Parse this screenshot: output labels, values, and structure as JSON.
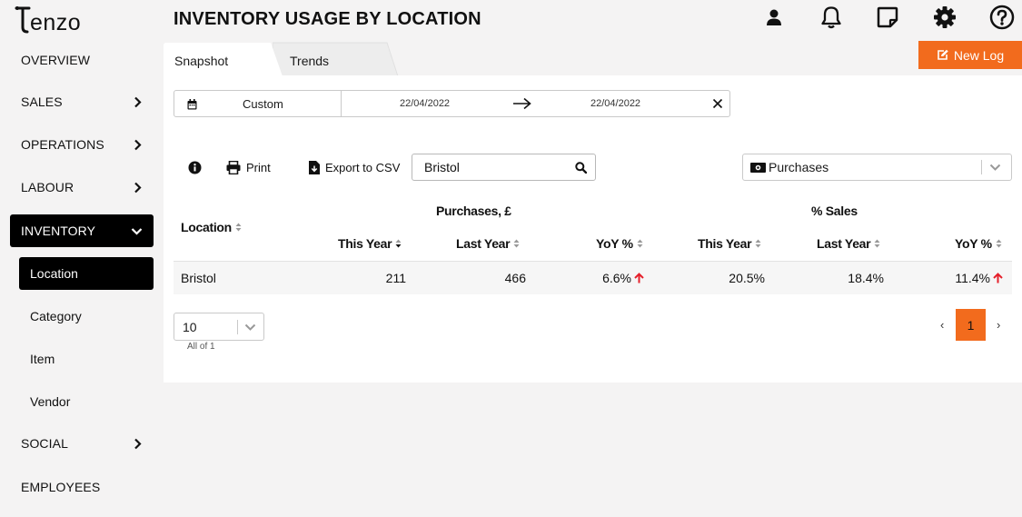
{
  "brand": {
    "logo_text": "Tenzo",
    "accent": "#f26b1d"
  },
  "sidebar": {
    "items": [
      {
        "label": "OVERVIEW",
        "chevron": "none"
      },
      {
        "label": "SALES",
        "chevron": "right"
      },
      {
        "label": "OPERATIONS",
        "chevron": "right"
      },
      {
        "label": "LABOUR",
        "chevron": "right"
      },
      {
        "label": "INVENTORY",
        "chevron": "down",
        "active": true
      },
      {
        "label": "SOCIAL",
        "chevron": "right"
      },
      {
        "label": "EMPLOYEES",
        "chevron": "none"
      }
    ],
    "inventory_sub": [
      {
        "label": "Location",
        "active": true
      },
      {
        "label": "Category"
      },
      {
        "label": "Item"
      },
      {
        "label": "Vendor"
      }
    ]
  },
  "header": {
    "title": "INVENTORY USAGE BY LOCATION",
    "icons": [
      "user-icon",
      "bell-icon",
      "note-icon",
      "gear-icon",
      "help-icon"
    ]
  },
  "tabs": [
    {
      "label": "Snapshot",
      "active": true
    },
    {
      "label": "Trends",
      "active": false
    }
  ],
  "new_log_label": "New Log",
  "date_range": {
    "preset": "Custom",
    "start": "22/04/2022",
    "end": "22/04/2022"
  },
  "toolbar": {
    "print_label": "Print",
    "export_label": "Export to CSV",
    "search_value": "Bristol",
    "metric_select": "Purchases"
  },
  "table": {
    "location_header": "Location",
    "groups": [
      "Purchases, £",
      "% Sales"
    ],
    "columns": [
      "This Year",
      "Last Year",
      "YoY %",
      "This Year",
      "Last Year",
      "YoY %"
    ],
    "rows": [
      {
        "location": "Bristol",
        "purchases_this_year": "211",
        "purchases_last_year": "466",
        "purchases_yoy": "6.6%",
        "sales_this_year": "20.5%",
        "sales_last_year": "18.4%",
        "sales_yoy": "11.4%"
      }
    ]
  },
  "pagination": {
    "page_size": "10",
    "summary": "All of 1",
    "prev": "‹",
    "current_page": "1",
    "next": "›"
  }
}
